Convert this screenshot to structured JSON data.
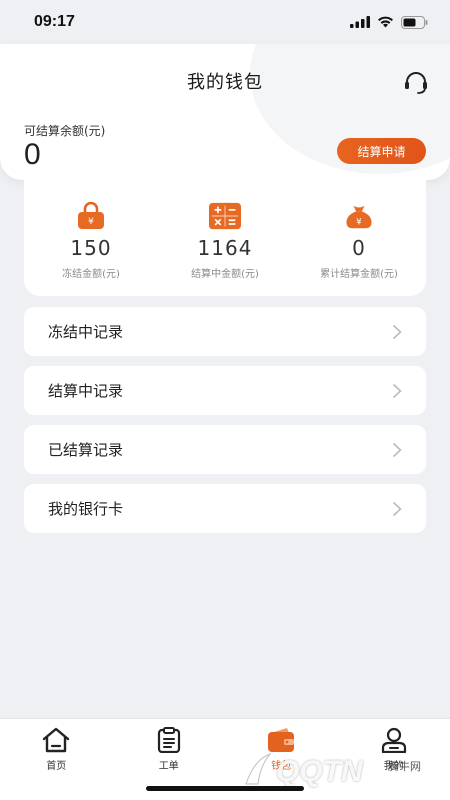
{
  "status_bar": {
    "time": "09:17"
  },
  "header": {
    "title": "我的钱包"
  },
  "balance": {
    "label": "可结算余额(元)",
    "value": "0",
    "settle_button": "结算申请"
  },
  "stats": [
    {
      "icon": "lock-bag-icon",
      "value": "150",
      "label": "冻结金额(元)"
    },
    {
      "icon": "calculator-icon",
      "value": "1164",
      "label": "结算中金额(元)"
    },
    {
      "icon": "money-bag-icon",
      "value": "0",
      "label": "累计结算金额(元)"
    }
  ],
  "menu": [
    {
      "label": "冻结中记录"
    },
    {
      "label": "结算中记录"
    },
    {
      "label": "已结算记录"
    },
    {
      "label": "我的银行卡"
    }
  ],
  "tabbar": [
    {
      "label": "首页",
      "icon": "home-icon"
    },
    {
      "label": "工单",
      "icon": "clipboard-icon"
    },
    {
      "label": "钱包",
      "icon": "wallet-icon",
      "active": true
    },
    {
      "label": "我的",
      "icon": "user-icon"
    }
  ],
  "watermark": {
    "text": "QQTN",
    "sub": "腾牛网"
  },
  "colors": {
    "accent": "#e3621f",
    "background": "#eef0f3",
    "card": "#ffffff"
  }
}
